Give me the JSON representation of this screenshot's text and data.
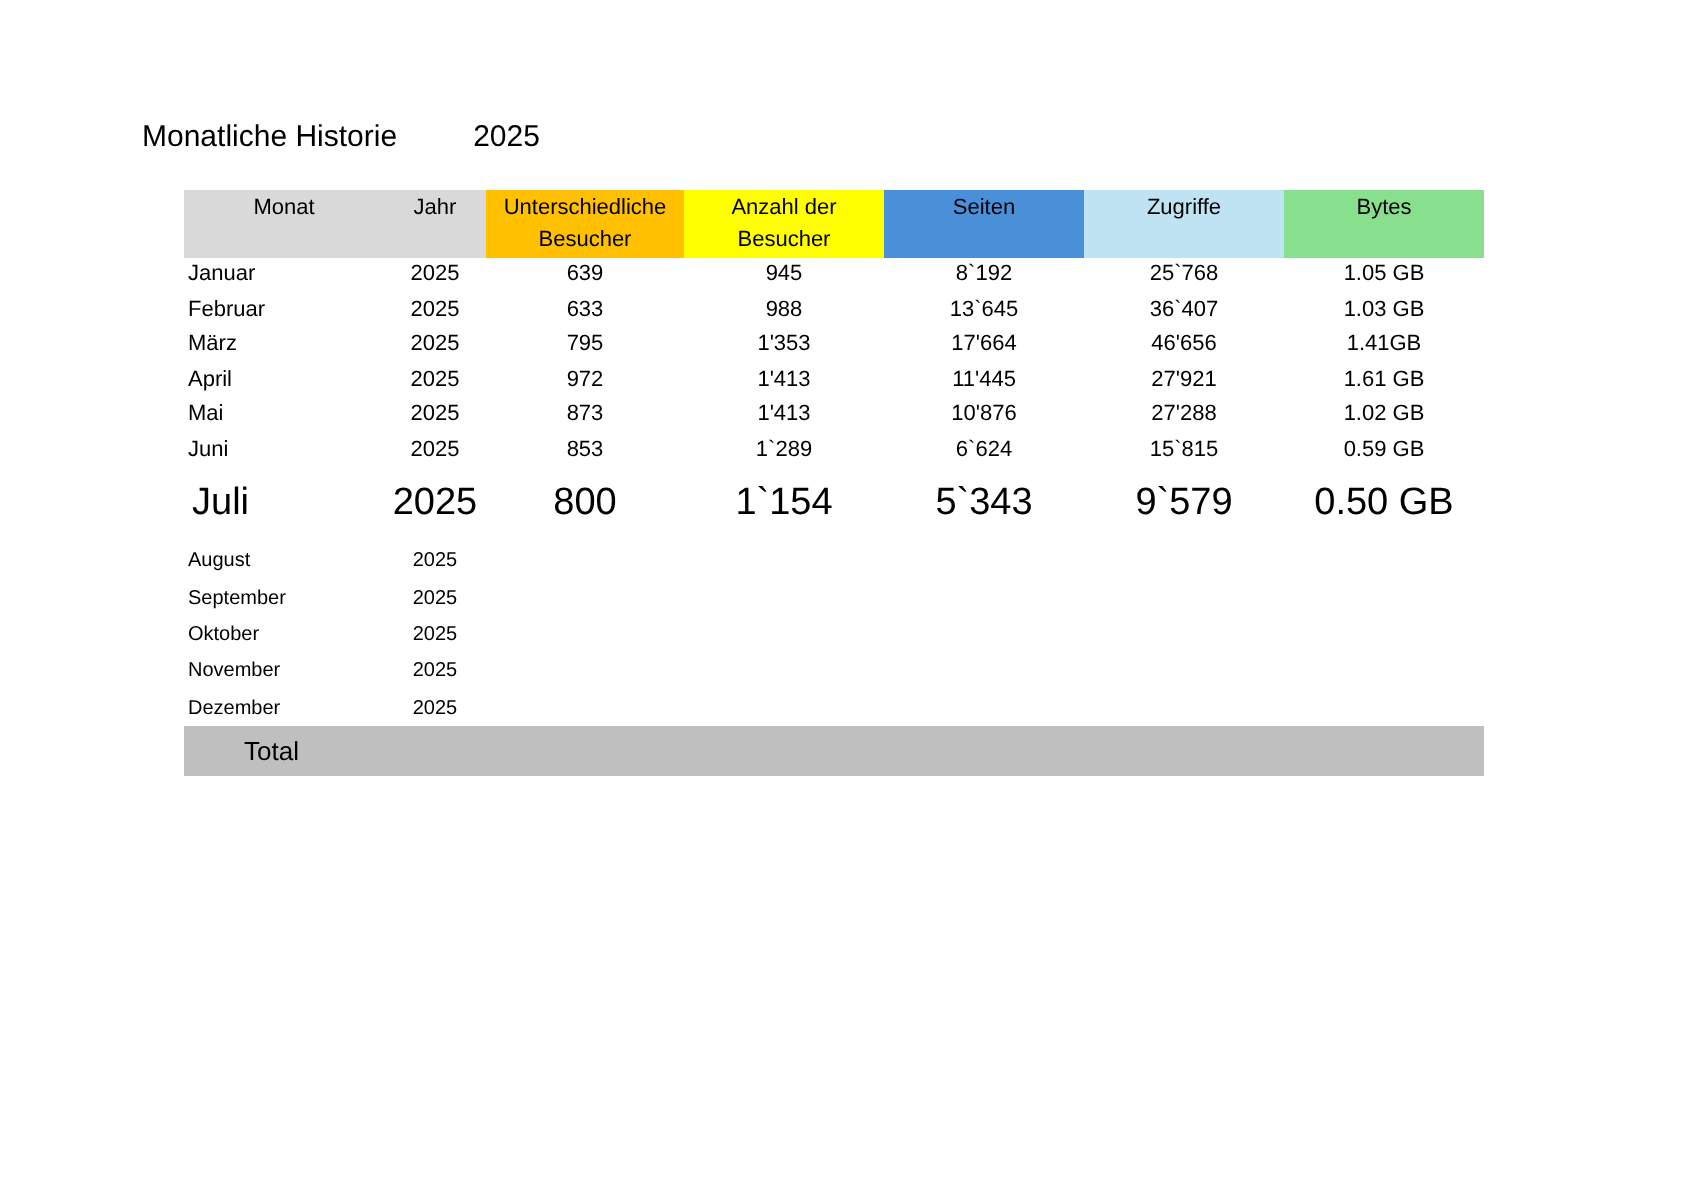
{
  "title": "Monatliche Historie",
  "year": "2025",
  "columns": [
    {
      "label": "Monat",
      "color": "#d9d9d9"
    },
    {
      "label": "Jahr",
      "color": "#d9d9d9"
    },
    {
      "label": "Unterschiedliche Besucher",
      "color": "#ffc000"
    },
    {
      "label": "Anzahl der Besucher",
      "color": "#ffff00"
    },
    {
      "label": "Seiten",
      "color": "#4a90d9"
    },
    {
      "label": "Zugriffe",
      "color": "#bfe3f3"
    },
    {
      "label": "Bytes",
      "color": "#88e08f"
    }
  ],
  "rows": [
    {
      "kind": "past",
      "cells": [
        "Januar",
        "2025",
        "639",
        "945",
        "8`192",
        "25`768",
        "1.05 GB"
      ]
    },
    {
      "kind": "past",
      "cells": [
        "Februar",
        "2025",
        "633",
        "988",
        "13`645",
        "36`407",
        "1.03 GB"
      ]
    },
    {
      "kind": "past",
      "cells": [
        "März",
        "2025",
        "795",
        "1'353",
        "17'664",
        "46'656",
        "1.41GB"
      ]
    },
    {
      "kind": "past",
      "cells": [
        "April",
        "2025",
        "972",
        "1'413",
        "11'445",
        "27'921",
        "1.61 GB"
      ]
    },
    {
      "kind": "past",
      "cells": [
        "Mai",
        "2025",
        "873",
        "1'413",
        "10'876",
        "27'288",
        "1.02 GB"
      ]
    },
    {
      "kind": "past",
      "cells": [
        "Juni",
        "2025",
        "853",
        "1`289",
        "6`624",
        "15`815",
        "0.59 GB"
      ]
    },
    {
      "kind": "current",
      "cells": [
        "Juli",
        "2025",
        "800",
        "1`154",
        "5`343",
        "9`579",
        "0.50 GB"
      ]
    },
    {
      "kind": "future",
      "cells": [
        "August",
        "2025"
      ]
    },
    {
      "kind": "future",
      "cells": [
        "September",
        "2025"
      ]
    },
    {
      "kind": "future",
      "cells": [
        "Oktober",
        "2025"
      ]
    },
    {
      "kind": "future",
      "cells": [
        "November",
        "2025"
      ]
    },
    {
      "kind": "future",
      "cells": [
        "Dezember",
        "2025"
      ]
    }
  ],
  "total": {
    "label": "Total"
  }
}
